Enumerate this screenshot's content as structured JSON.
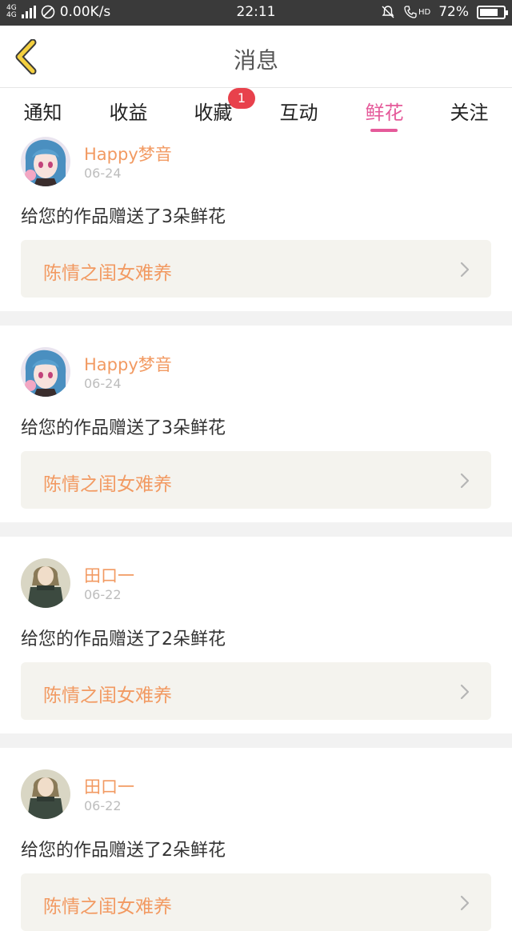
{
  "status_bar": {
    "network_top": "4G",
    "network_mid": "4G",
    "speed": "0.00K/s",
    "time": "22:11",
    "hd": "HD",
    "battery": "72%",
    "battery_level": 0.72
  },
  "header": {
    "title": "消息"
  },
  "tabs": [
    {
      "label": "通知",
      "active": false
    },
    {
      "label": "收益",
      "active": false
    },
    {
      "label": "收藏",
      "active": false,
      "badge": "1"
    },
    {
      "label": "互动",
      "active": false
    },
    {
      "label": "鲜花",
      "active": true
    },
    {
      "label": "关注",
      "active": false
    }
  ],
  "colors": {
    "accent": "#e55a9a",
    "username": "#f29a62",
    "badge": "#e8414c",
    "card_bg": "#f4f3ee"
  },
  "feed": [
    {
      "user": "Happy梦音",
      "date": "06-24",
      "message": "给您的作品赠送了3朵鲜花",
      "work_title": "陈情之闺女难养",
      "avatar": "anime-girl-blue-hair"
    },
    {
      "user": "Happy梦音",
      "date": "06-24",
      "message": "给您的作品赠送了3朵鲜花",
      "work_title": "陈情之闺女难养",
      "avatar": "anime-girl-blue-hair"
    },
    {
      "user": "田口一",
      "date": "06-22",
      "message": "给您的作品赠送了2朵鲜花",
      "work_title": "陈情之闺女难养",
      "avatar": "girl-dark-dress"
    },
    {
      "user": "田口一",
      "date": "06-22",
      "message": "给您的作品赠送了2朵鲜花",
      "work_title": "陈情之闺女难养",
      "avatar": "girl-dark-dress"
    }
  ]
}
